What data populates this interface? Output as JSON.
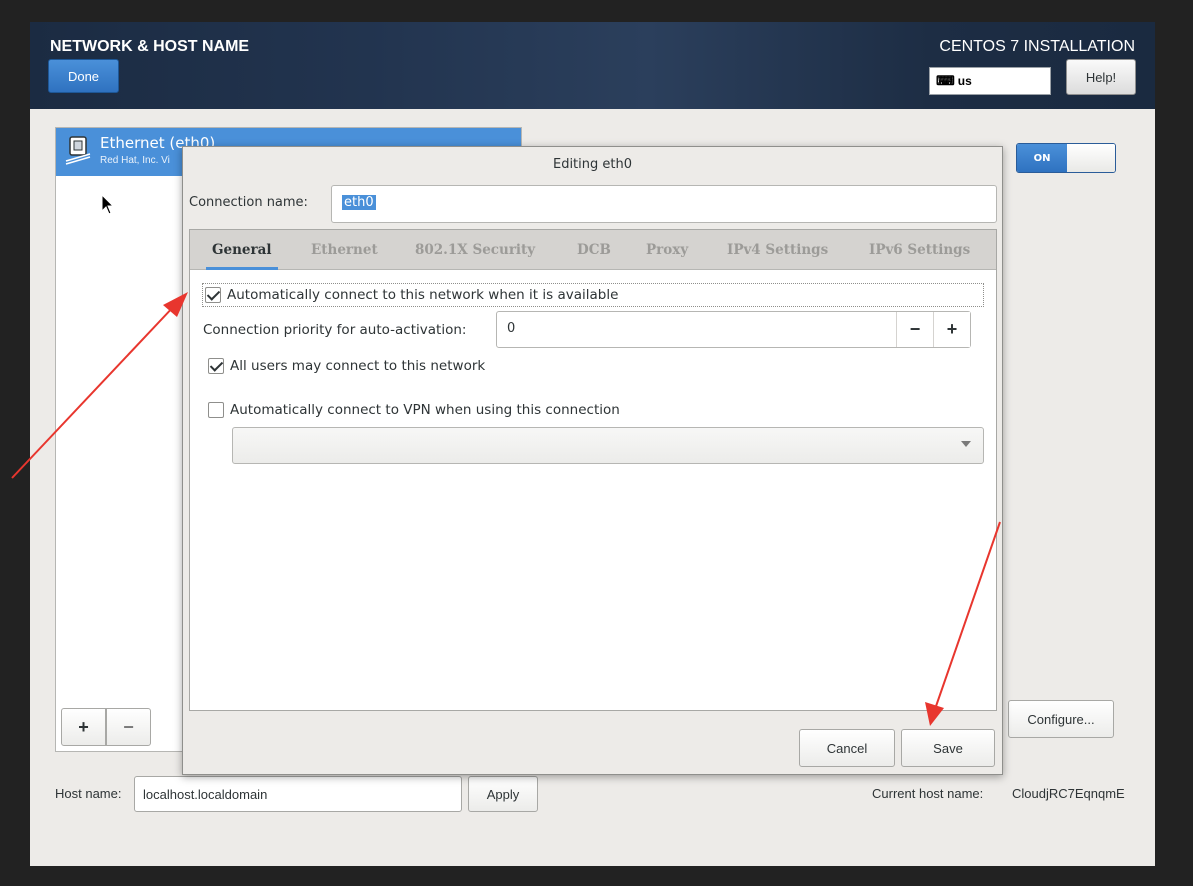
{
  "header": {
    "spoke_title": "NETWORK & HOST NAME",
    "done_label": "Done",
    "product_title": "CENTOS 7 INSTALLATION",
    "keyboard_layout": "us",
    "help_label": "Help!"
  },
  "device": {
    "name": "Ethernet (eth0)",
    "vendor": "Red Hat, Inc. Vi",
    "toggle_label": "ON"
  },
  "list_toolbar": {
    "add_label": "+",
    "remove_label": "−"
  },
  "configure_label": "Configure...",
  "hostname": {
    "label": "Host name:",
    "value": "localhost.localdomain",
    "apply_label": "Apply",
    "current_label": "Current host name:",
    "current_value": "CloudjRC7EqnqmE"
  },
  "dialog": {
    "title": "Editing eth0",
    "connection_name_label": "Connection name:",
    "connection_name_value": "eth0",
    "tabs": [
      "General",
      "Ethernet",
      "802.1X Security",
      "DCB",
      "Proxy",
      "IPv4 Settings",
      "IPv6 Settings"
    ],
    "active_tab": "General",
    "auto_connect": {
      "label": "Automatically connect to this network when it is available",
      "checked": true
    },
    "priority": {
      "label": "Connection priority for auto-activation:",
      "value": "0",
      "minus": "−",
      "plus": "+"
    },
    "all_users": {
      "label": "All users may connect to this network",
      "checked": true
    },
    "vpn": {
      "label": "Automatically connect to VPN when using this connection",
      "checked": false
    },
    "cancel_label": "Cancel",
    "save_label": "Save"
  },
  "colors": {
    "accent": "#4a90d9",
    "header_bg": "#1b2b42",
    "annotation_arrow": "#e8362e"
  }
}
